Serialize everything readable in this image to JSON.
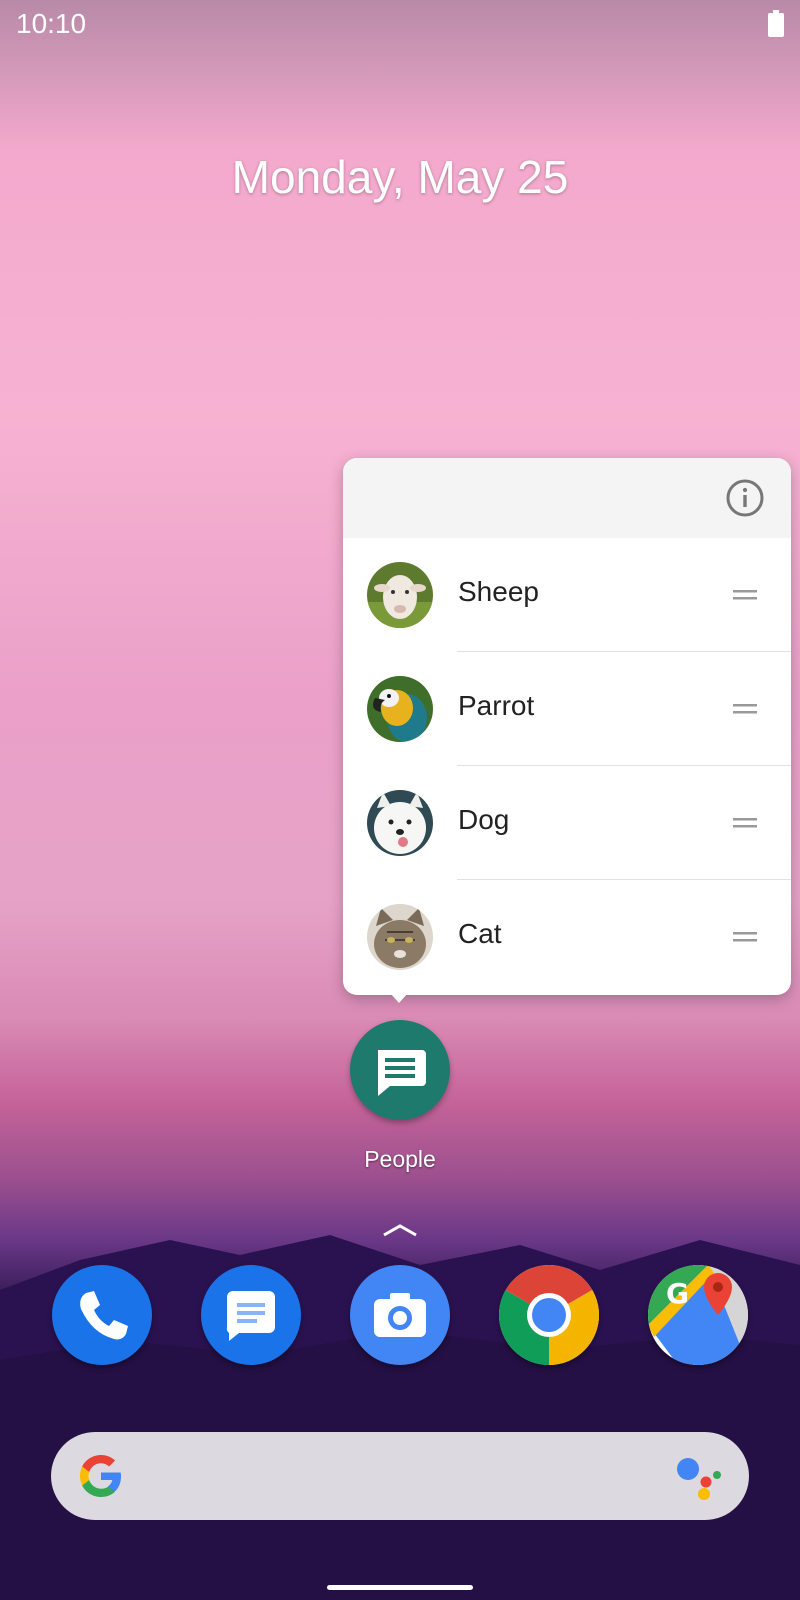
{
  "status_bar": {
    "time": "10:10",
    "battery_icon": "battery-full-icon"
  },
  "date_widget": {
    "text": "Monday, May 25"
  },
  "shortcut_popup": {
    "header_icon": "info-icon",
    "items": [
      {
        "label": "Sheep",
        "avatar_icon": "sheep-photo-icon",
        "handle_icon": "drag-handle-icon"
      },
      {
        "label": "Parrot",
        "avatar_icon": "parrot-photo-icon",
        "handle_icon": "drag-handle-icon"
      },
      {
        "label": "Dog",
        "avatar_icon": "dog-photo-icon",
        "handle_icon": "drag-handle-icon"
      },
      {
        "label": "Cat",
        "avatar_icon": "cat-photo-icon",
        "handle_icon": "drag-handle-icon"
      }
    ]
  },
  "app_icon": {
    "label": "People",
    "icon": "message-icon",
    "color": "#1e7a6c"
  },
  "dock": {
    "apps": [
      {
        "icon": "phone-icon",
        "color": "#1a73e8"
      },
      {
        "icon": "messages-icon",
        "color": "#1a73e8"
      },
      {
        "icon": "camera-icon",
        "color": "#4285f4"
      },
      {
        "icon": "chrome-icon",
        "color": "#4285f4"
      },
      {
        "icon": "maps-icon",
        "color": "#34a853"
      }
    ]
  },
  "search_bar": {
    "left_icon": "google-g-icon",
    "right_icon": "assistant-icon"
  }
}
